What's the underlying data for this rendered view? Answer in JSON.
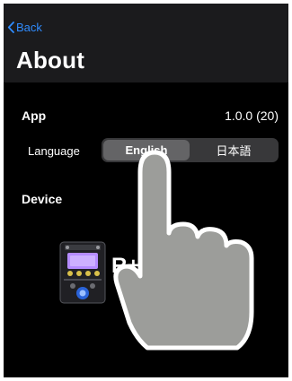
{
  "navbar": {
    "back_label": "Back",
    "title": "About"
  },
  "app_section": {
    "label": "App",
    "version": "1.0.0 (20)"
  },
  "language": {
    "label": "Language",
    "options": [
      "English",
      "日本語"
    ],
    "selected": "English"
  },
  "device_section": {
    "label": "Device",
    "device_name": "R+"
  },
  "colors": {
    "accent": "#2f8cff",
    "navbar_bg": "#1b1b1d",
    "background": "#000000",
    "segment_selected": "#646466",
    "device_screen": "#b58cff"
  },
  "icons": {
    "back": "chevron-left-icon",
    "device": "effects-pedal-icon",
    "overlay": "pointing-hand-icon"
  }
}
